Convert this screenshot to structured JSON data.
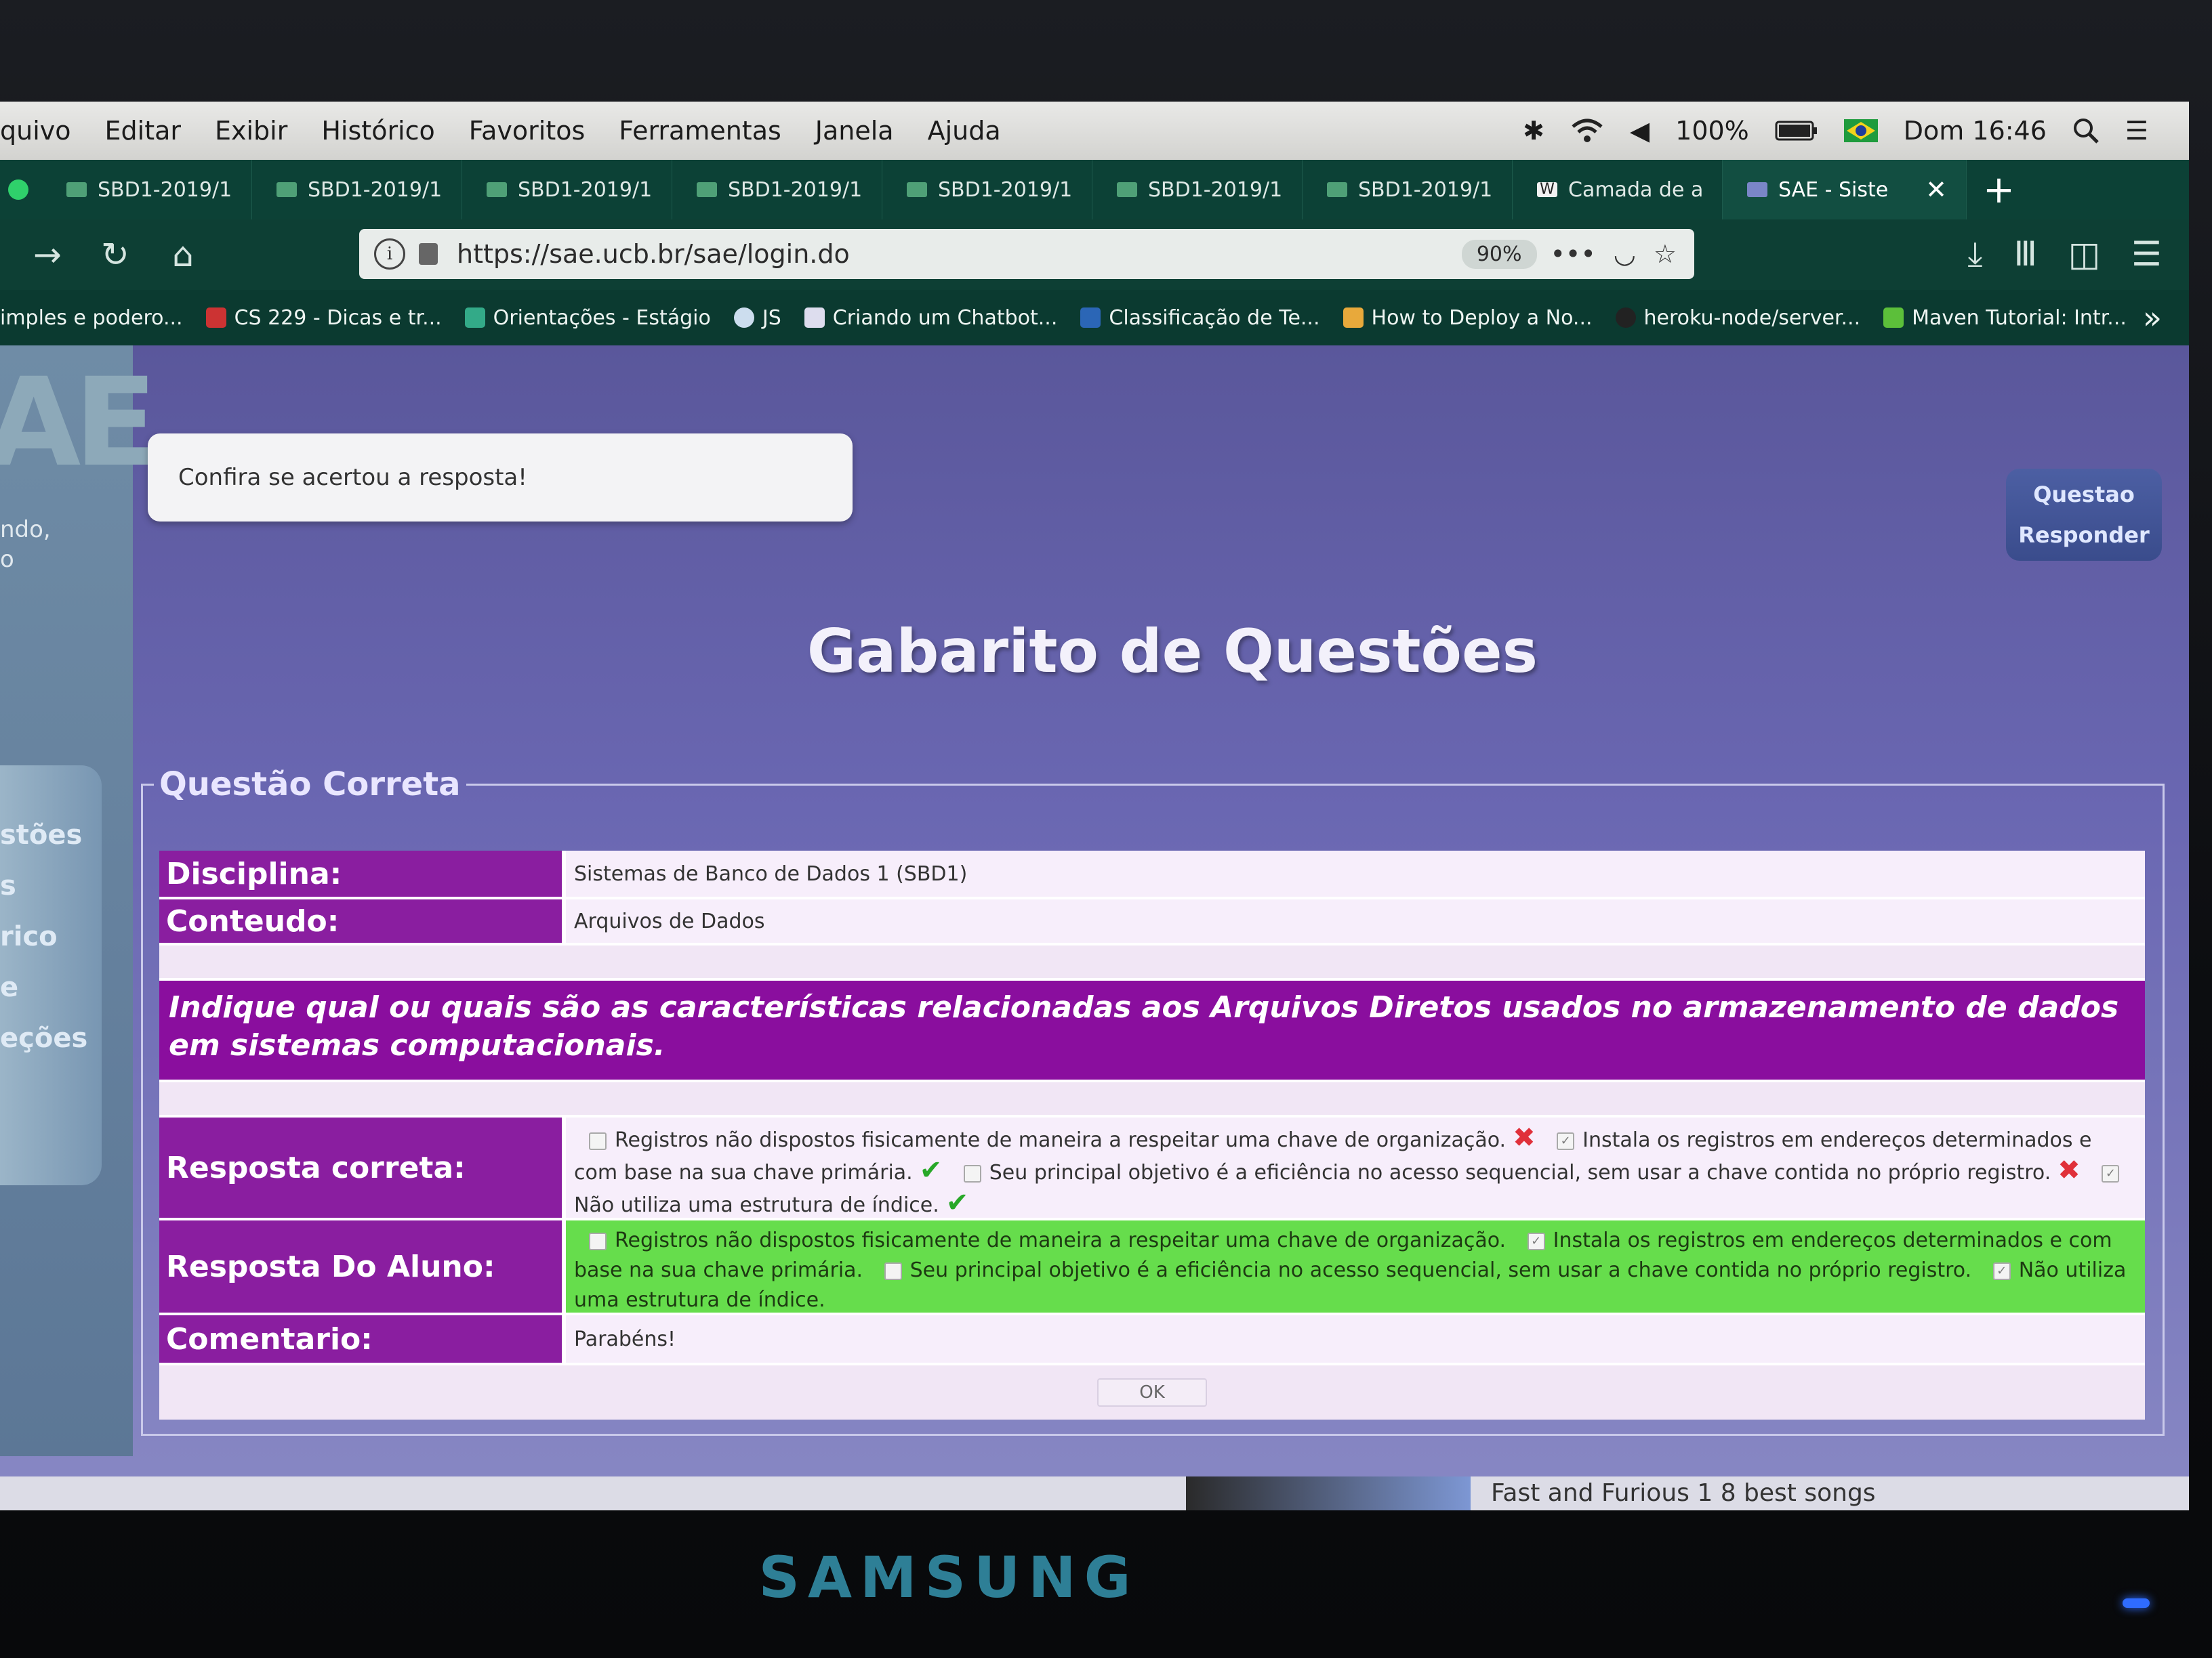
{
  "menubar": {
    "items": [
      "quivo",
      "Editar",
      "Exibir",
      "Histórico",
      "Favoritos",
      "Ferramentas",
      "Janela",
      "Ajuda"
    ],
    "battery": "100%",
    "clock": "Dom 16:46"
  },
  "tabs": [
    {
      "label": "SBD1-2019/1"
    },
    {
      "label": "SBD1-2019/1"
    },
    {
      "label": "SBD1-2019/1"
    },
    {
      "label": "SBD1-2019/1"
    },
    {
      "label": "SBD1-2019/1"
    },
    {
      "label": "SBD1-2019/1"
    },
    {
      "label": "SBD1-2019/1"
    },
    {
      "label": "Camada de a"
    },
    {
      "label": "SAE - Siste"
    }
  ],
  "navbar": {
    "url": "https://sae.ucb.br/sae/login.do",
    "zoom": "90%"
  },
  "bookmarks": [
    {
      "label": "imples e podero..."
    },
    {
      "label": "CS 229 - Dicas e tr..."
    },
    {
      "label": "Orientações - Estágio"
    },
    {
      "label": "JS"
    },
    {
      "label": "Criando um Chatbot..."
    },
    {
      "label": "Classificação de Te..."
    },
    {
      "label": "How to Deploy a No..."
    },
    {
      "label": "heroku-node/server..."
    },
    {
      "label": "Maven Tutorial: Intr..."
    }
  ],
  "sidebar": {
    "logo": "AE",
    "subtext": [
      "ndo,",
      "o"
    ],
    "items": [
      "stões",
      "s",
      "rico",
      "e",
      "eções"
    ]
  },
  "header": {
    "message": "Confira se acertou a resposta!",
    "btn_questao": "Questao",
    "btn_responder": "Responder"
  },
  "page": {
    "title": "Gabarito de Questões",
    "legend": "Questão Correta"
  },
  "table": {
    "disciplina_label": "Disciplina:",
    "disciplina_value": "Sistemas de Banco de Dados 1 (SBD1)",
    "conteudo_label": "Conteudo:",
    "conteudo_value": "Arquivos de Dados",
    "question": "Indique qual ou quais são as características relacionadas aos Arquivos Diretos usados no armazenamento de dados em sistemas computacionais.",
    "resposta_correta_label": "Resposta correta:",
    "resposta_aluno_label": "Resposta Do Aluno:",
    "comentario_label": "Comentario:",
    "comentario_value": "Parabéns!",
    "ok_label": "OK"
  },
  "options": [
    {
      "text": "Registros não dispostos fisicamente de maneira a respeitar uma chave de organização.",
      "correct_checked": false,
      "student_checked": false,
      "mark": "x"
    },
    {
      "text": "Instala os registros em endereços determinados e com base na sua chave primária.",
      "correct_checked": true,
      "student_checked": true,
      "mark": "ok"
    },
    {
      "text": "Seu principal objetivo é a eficiência no acesso sequencial, sem usar a chave contida no próprio registro.",
      "correct_checked": false,
      "student_checked": false,
      "mark": "x"
    },
    {
      "text": "Não utiliza uma estrutura de índice.",
      "correct_checked": true,
      "student_checked": true,
      "mark": "ok"
    }
  ],
  "taskbar": {
    "song": "Fast and Furious 1 8 best songs"
  },
  "monitor": {
    "brand": "SAMSUNG"
  },
  "colors": {
    "label_purple": "#8a1ea0",
    "question_purple": "#8a0e9e",
    "student_green": "#66dd4c",
    "correct_mark": "#28a828",
    "wrong_mark": "#e0303a"
  }
}
